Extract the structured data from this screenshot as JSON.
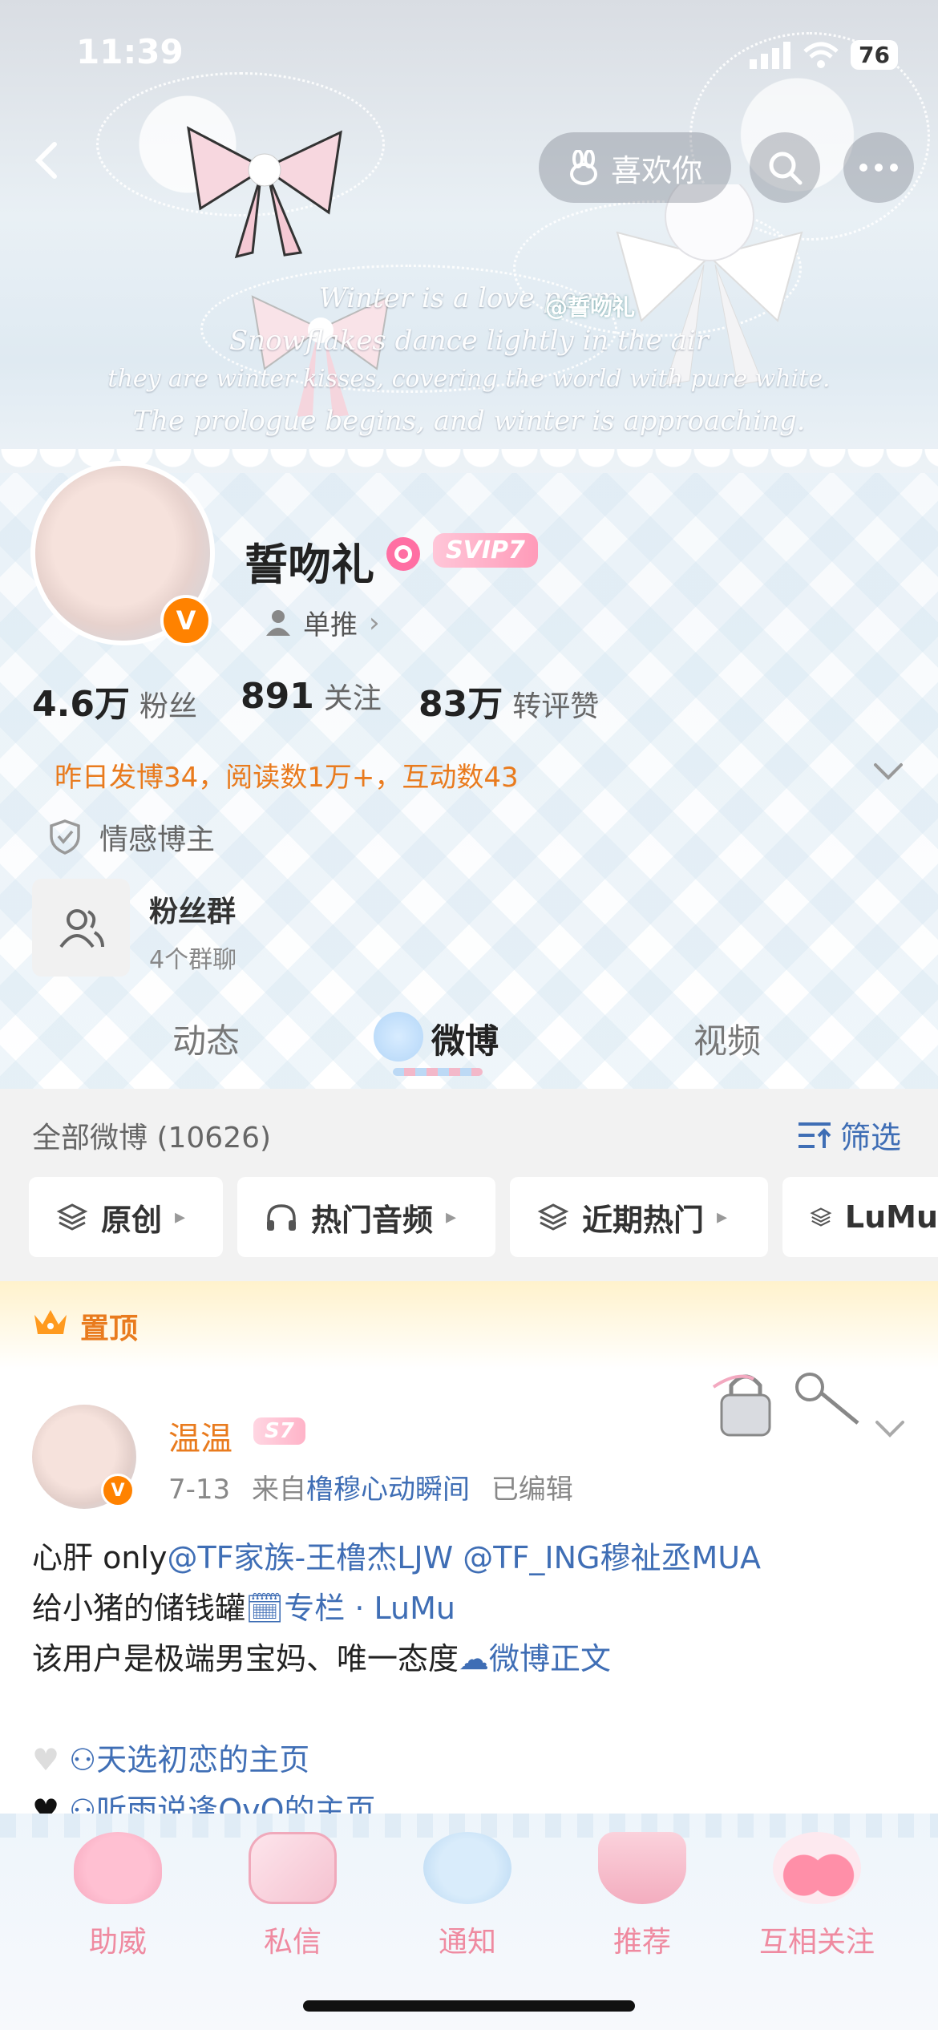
{
  "status_bar": {
    "time": "11:39",
    "battery": "76"
  },
  "header": {
    "like_button": "喜欢你",
    "watermark": "@誓吻礼",
    "script_lines": [
      "Winter is a love poem",
      "Snowflakes dance lightly in the air",
      "they are winter kisses, covering the world with pure white.",
      "The prologue begins, and winter is approaching."
    ]
  },
  "profile": {
    "name": "誓吻礼",
    "svip": "SVIP7",
    "verified_badge": "V",
    "single_push": "单推",
    "stats": [
      {
        "num": "4.6万",
        "label": "粉丝"
      },
      {
        "num": "891",
        "label": "关注"
      },
      {
        "num": "83万",
        "label": "转评赞"
      }
    ],
    "activity": "昨日发博34，阅读数1万+，互动数43",
    "tag": "情感博主",
    "fan_group": {
      "title": "粉丝群",
      "subtitle": "4个群聊"
    }
  },
  "tabs": [
    {
      "label": "动态",
      "active": false
    },
    {
      "label": "微博",
      "active": true
    },
    {
      "label": "视频",
      "active": false
    }
  ],
  "feed": {
    "all_label": "全部微博 (10626)",
    "filter_label": "筛选",
    "chips": [
      "原创",
      "热门音频",
      "近期热门",
      "LuMu"
    ]
  },
  "pinned": {
    "label": "置顶",
    "author": "温温",
    "author_badge": "S7",
    "date": "7-13",
    "source_prefix": "来自",
    "source": "橹穆心动瞬间",
    "edited": "已编辑",
    "line1_prefix": "心肝 only",
    "mention1": "@TF家族-王橹杰LJW",
    "mention2": "@TF_ING穆祉丞MUA",
    "line2_prefix": "给小猪的储钱罐",
    "line2_link": "专栏 · LuMu",
    "line3_prefix": "该用户是极端男宝妈、唯一态度",
    "line3_link": "微博正文",
    "line4_link": "天选初恋的主页",
    "line5_link": "听雨说逢OvO的主页"
  },
  "bottom_nav": [
    "助威",
    "私信",
    "通知",
    "推荐",
    "互相关注"
  ],
  "colors": {
    "orange": "#ff8200",
    "link": "#3f6eb5",
    "nav_pink": "#ef8aa0"
  }
}
